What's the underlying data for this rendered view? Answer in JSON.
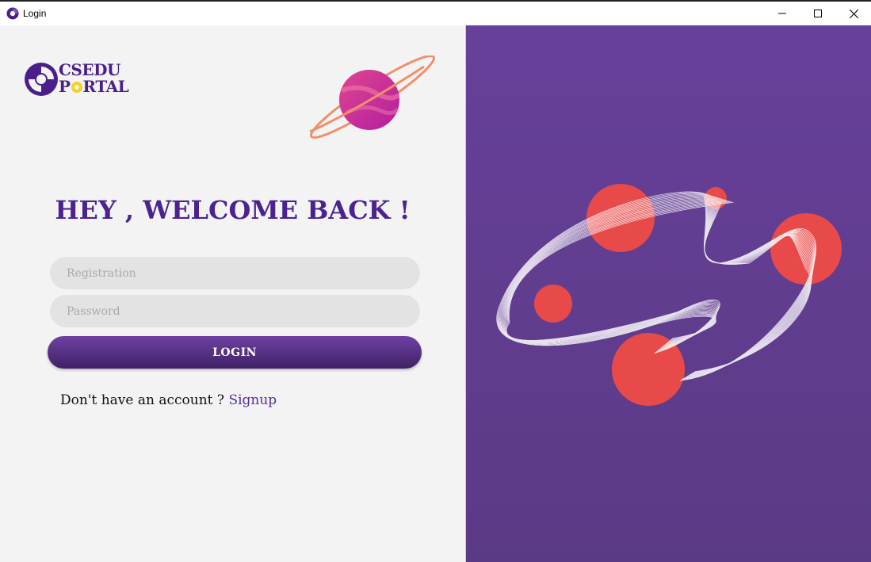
{
  "window": {
    "title": "Login",
    "controls": [
      "minimize",
      "maximize",
      "close"
    ]
  },
  "logo": {
    "line1": "CSEDU",
    "line2_prefix": "P",
    "line2_suffix": "RTAL"
  },
  "heading": "HEY , WELCOME BACK !",
  "form": {
    "registration_placeholder": "Registration",
    "password_placeholder": "Password",
    "login_label": "LOGIN"
  },
  "signup": {
    "prompt": "Don't have an account ?",
    "link": "Signup"
  },
  "colors": {
    "brand_purple": "#4b2290",
    "panel_purple": "#63409a",
    "accent_red": "#e84a4a",
    "logo_yellow": "#f4d21f"
  },
  "icons": [
    "app-icon",
    "minimize-icon",
    "maximize-icon",
    "close-icon",
    "csedu-logo-icon",
    "planet-illustration",
    "abstract-waves-illustration"
  ]
}
